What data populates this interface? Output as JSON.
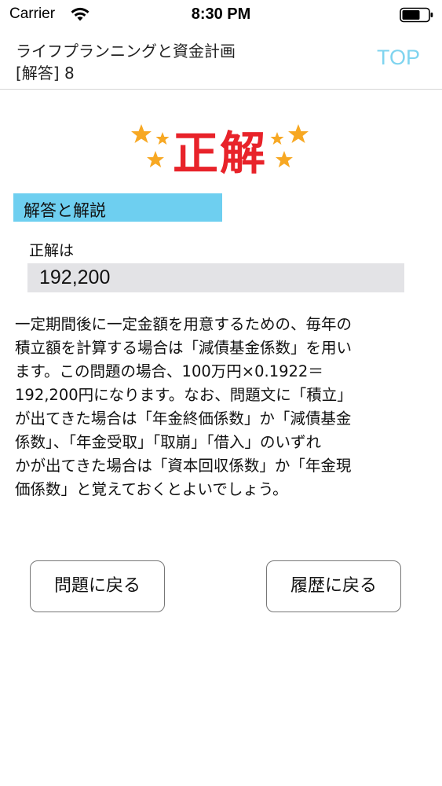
{
  "status_bar": {
    "carrier": "Carrier",
    "time": "8:30 PM",
    "wifi_icon": "wifi-icon",
    "battery_icon": "battery-icon"
  },
  "header": {
    "title_line1": "ライフプランニングと資金計画",
    "title_line2": "[解答] 8",
    "top_label": "TOP",
    "top_color": "#7fd4ef"
  },
  "result": {
    "label": "正解",
    "color": "#e8232a",
    "decoration_icon": "star-icon",
    "star_color": "#f7a823"
  },
  "section": {
    "title": "解答と解説",
    "background": "#6ecff0"
  },
  "answer": {
    "label": "正解は",
    "value": "192,200"
  },
  "explanation_lines": [
    "一定期間後に一定金額を用意するための、毎年の",
    "積立額を計算する場合は「減債基金係数」を用い",
    "ます。この問題の場合、100万円×0.1922＝",
    "192,200円になります。なお、問題文に「積立」",
    "が出てきた場合は「年金終価係数」か「減債基金",
    "係数」、「年金受取」「取崩」「借入」のいずれ",
    "かが出てきた場合は「資本回収係数」か「年金現",
    "価係数」と覚えておくとよいでしょう。"
  ],
  "buttons": {
    "back_to_question": "問題に戻る",
    "back_to_history": "履歴に戻る"
  }
}
